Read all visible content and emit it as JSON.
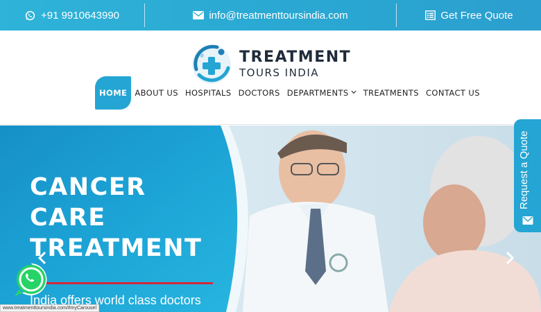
{
  "topbar": {
    "phone": "+91 9910643990",
    "email": "info@treatmenttoursindia.com",
    "quote": "Get Free Quote",
    "icons": {
      "phone": "whatsapp-phone-icon",
      "email": "envelope-icon",
      "quote": "list-form-icon"
    }
  },
  "logo": {
    "line1": "TREATMENT",
    "line2": "TOURS INDIA"
  },
  "nav": [
    {
      "label": "HOME",
      "active": true
    },
    {
      "label": "ABOUT US"
    },
    {
      "label": "HOSPITALS"
    },
    {
      "label": "DOCTORS"
    },
    {
      "label": "DEPARTMENTS",
      "dropdown": true
    },
    {
      "label": "TREATMENTS"
    },
    {
      "label": "CONTACT US"
    }
  ],
  "hero": {
    "title_line1": "CANCER",
    "title_line2": "CARE",
    "title_line3": "TREATMENT",
    "subtitle": "India offers world class doctors"
  },
  "side_tab": {
    "label": "Request a Quote"
  },
  "status_url": "www.treatmenttoursindia.com/#myCarousel",
  "colors": {
    "brand_blue": "#24a5d3",
    "accent_red": "#d6263a",
    "dark_text": "#1f2b3a",
    "whatsapp_green": "#25d366"
  }
}
